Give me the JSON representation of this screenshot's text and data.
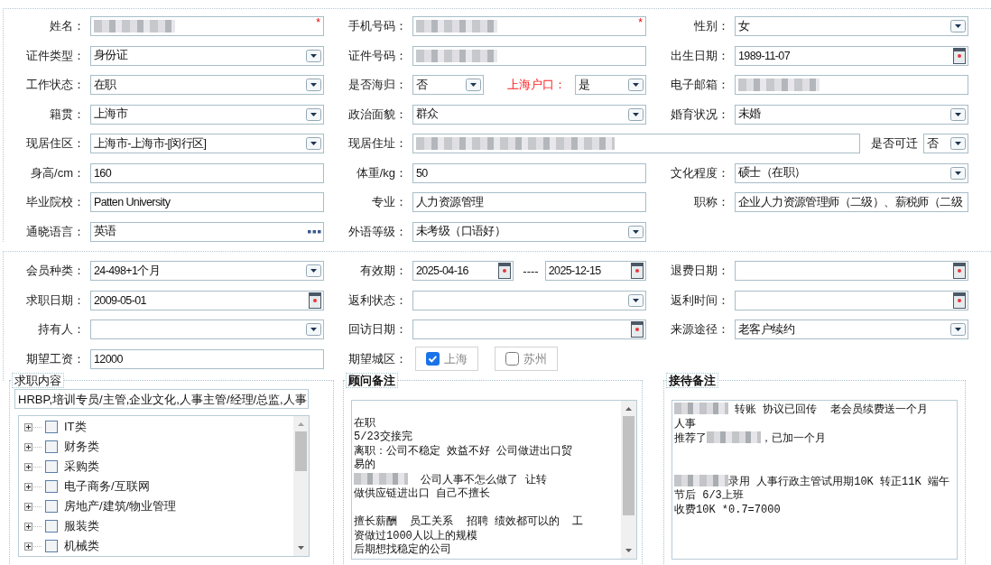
{
  "sections": [
    {
      "rows": [
        [
          {
            "label": "姓名：",
            "items": [
              {
                "kind": "text",
                "blurred": true,
                "mark": "*"
              }
            ]
          },
          {
            "label": "手机号码：",
            "items": [
              {
                "kind": "text",
                "blurred": true,
                "mark": "*"
              }
            ]
          },
          {
            "label": "性别：",
            "items": [
              {
                "kind": "select",
                "value": "女"
              }
            ]
          }
        ],
        [
          {
            "label": "证件类型：",
            "items": [
              {
                "kind": "select",
                "value": "身份证"
              }
            ]
          },
          {
            "label": "证件号码：",
            "items": [
              {
                "kind": "text",
                "blurred": true
              }
            ]
          },
          {
            "label": "出生日期：",
            "items": [
              {
                "kind": "date",
                "value": "1989-11-07"
              }
            ]
          }
        ],
        [
          {
            "label": "工作状态：",
            "items": [
              {
                "kind": "select",
                "value": "在职"
              }
            ]
          },
          {
            "label": "是否海归：",
            "items": [
              {
                "kind": "select",
                "value": "否"
              },
              {
                "kind": "label",
                "text": "上海户口：",
                "highlight": true
              },
              {
                "kind": "select",
                "value": "是"
              }
            ]
          },
          {
            "label": "电子邮箱：",
            "items": [
              {
                "kind": "text",
                "blurred": true
              }
            ]
          }
        ],
        [
          {
            "label": "籍贯：",
            "items": [
              {
                "kind": "select",
                "value": "上海市"
              }
            ]
          },
          {
            "label": "政治面貌：",
            "items": [
              {
                "kind": "select",
                "value": "群众"
              }
            ]
          },
          {
            "label": "婚育状况：",
            "items": [
              {
                "kind": "select",
                "value": "未婚"
              }
            ]
          }
        ],
        [
          {
            "label": "现居住区：",
            "items": [
              {
                "kind": "select",
                "value": "上海市-上海市-[闵行区]"
              }
            ]
          },
          {
            "label": "现居住址：",
            "kind": "address",
            "items": [
              {
                "kind": "text",
                "blurred": true
              },
              {
                "kind": "label",
                "text": "是否可迁",
                "highlight": false
              },
              {
                "kind": "select",
                "value": "否"
              }
            ]
          }
        ],
        [
          {
            "label": "身高/cm：",
            "items": [
              {
                "kind": "text",
                "value": "160"
              }
            ]
          },
          {
            "label": "体重/kg：",
            "items": [
              {
                "kind": "text",
                "value": "50"
              }
            ]
          },
          {
            "label": "文化程度：",
            "items": [
              {
                "kind": "select",
                "value": "硕士（在职）"
              }
            ]
          }
        ],
        [
          {
            "label": "毕业院校：",
            "items": [
              {
                "kind": "text",
                "value": "Patten University"
              }
            ]
          },
          {
            "label": "专业：",
            "items": [
              {
                "kind": "text",
                "value": "人力资源管理"
              }
            ]
          },
          {
            "label": "职称：",
            "items": [
              {
                "kind": "text",
                "value": "企业人力资源管理师（二级）、薪税师（二级"
              }
            ]
          }
        ],
        [
          {
            "label": "通晓语言：",
            "items": [
              {
                "kind": "lookup",
                "value": "英语"
              }
            ]
          },
          {
            "label": "外语等级：",
            "items": [
              {
                "kind": "select",
                "value": "未考级（口语好）"
              }
            ]
          }
        ]
      ]
    },
    {
      "rows": [
        [
          {
            "label": "会员种类：",
            "items": [
              {
                "kind": "select",
                "value": "24-498+1个月"
              }
            ]
          },
          {
            "label": "有效期：",
            "items": [
              {
                "kind": "date",
                "value": "2025-04-16"
              },
              {
                "kind": "separator",
                "text": "----"
              },
              {
                "kind": "date",
                "value": "2025-12-15"
              }
            ]
          },
          {
            "label": "退费日期：",
            "items": [
              {
                "kind": "date"
              }
            ]
          }
        ],
        [
          {
            "label": "求职日期：",
            "items": [
              {
                "kind": "date",
                "value": "2009-05-01"
              }
            ]
          },
          {
            "label": "返利状态：",
            "items": [
              {
                "kind": "select"
              }
            ]
          },
          {
            "label": "返利时间：",
            "items": [
              {
                "kind": "date"
              }
            ]
          }
        ],
        [
          {
            "label": "持有人：",
            "items": [
              {
                "kind": "select"
              }
            ]
          },
          {
            "label": "回访日期：",
            "items": [
              {
                "kind": "date"
              }
            ]
          },
          {
            "label": "来源途径：",
            "items": [
              {
                "kind": "select",
                "value": "老客户续约"
              }
            ]
          }
        ],
        [
          {
            "label": "期望工资：",
            "items": [
              {
                "kind": "text",
                "value": "12000"
              }
            ]
          },
          {
            "label": "期望城区：",
            "items": [
              {
                "kind": "checkbutton",
                "text": "上海",
                "checked": true
              },
              {
                "kind": "checkbutton",
                "text": "苏州",
                "checked": false
              }
            ]
          }
        ]
      ]
    }
  ],
  "job_intent": {
    "title": "求职内容",
    "value": "HRBP,培训专员/主管,企业文化,人事主管/经理/总监,人事",
    "tree": [
      {
        "label": "IT类",
        "checked": false,
        "expanded": false
      },
      {
        "label": "财务类",
        "checked": false,
        "expanded": false
      },
      {
        "label": "采购类",
        "checked": false,
        "expanded": false
      },
      {
        "label": "电子商务/互联网",
        "checked": false,
        "expanded": false
      },
      {
        "label": "房地产/建筑/物业管理",
        "checked": false,
        "expanded": false
      },
      {
        "label": "服装类",
        "checked": false,
        "expanded": false
      },
      {
        "label": "机械类",
        "checked": false,
        "expanded": false
      }
    ]
  },
  "notes": [
    {
      "title": "顾问备注",
      "lines": [
        {
          "kind": "blank"
        },
        {
          "parts": [
            {
              "text": "在职"
            }
          ]
        },
        {
          "parts": [
            {
              "text": "5/23交接完"
            }
          ]
        },
        {
          "parts": [
            {
              "text": "离职：公司不稳定 效益不好 公司做进出口贸"
            }
          ]
        },
        {
          "parts": [
            {
              "text": "易的"
            }
          ]
        },
        {
          "parts": [
            {
              "kind": "redacted"
            },
            {
              "text": "  公司人事不怎么做了 让转"
            }
          ]
        },
        {
          "parts": [
            {
              "text": "做供应链进出口 自己不擅长"
            }
          ]
        },
        {
          "kind": "blank"
        },
        {
          "parts": [
            {
              "text": "擅长薪酬  员工关系  招聘 绩效都可以的  工"
            }
          ]
        },
        {
          "parts": [
            {
              "text": "资做过1000人以上的规模"
            }
          ]
        },
        {
          "parts": [
            {
              "text": "后期想找稳定的公司"
            }
          ]
        }
      ]
    },
    {
      "title": "接待备注",
      "lines": [
        {
          "parts": [
            {
              "kind": "redacted"
            },
            {
              "text": " 转账 协议已回传  老会员续费送一个月"
            }
          ]
        },
        {
          "parts": [
            {
              "text": "人事"
            }
          ]
        },
        {
          "parts": [
            {
              "text": "推荐了"
            },
            {
              "kind": "redacted"
            },
            {
              "text": "，已加一个月"
            }
          ]
        },
        {
          "kind": "blank"
        },
        {
          "kind": "blank"
        },
        {
          "parts": [
            {
              "kind": "redacted"
            },
            {
              "text": "录用 人事行政主管试用期10K 转正11K 端午"
            }
          ]
        },
        {
          "parts": [
            {
              "text": "节后 6/3上班"
            }
          ]
        },
        {
          "parts": [
            {
              "text": "收费10K *0.7=7000"
            }
          ]
        }
      ]
    }
  ]
}
